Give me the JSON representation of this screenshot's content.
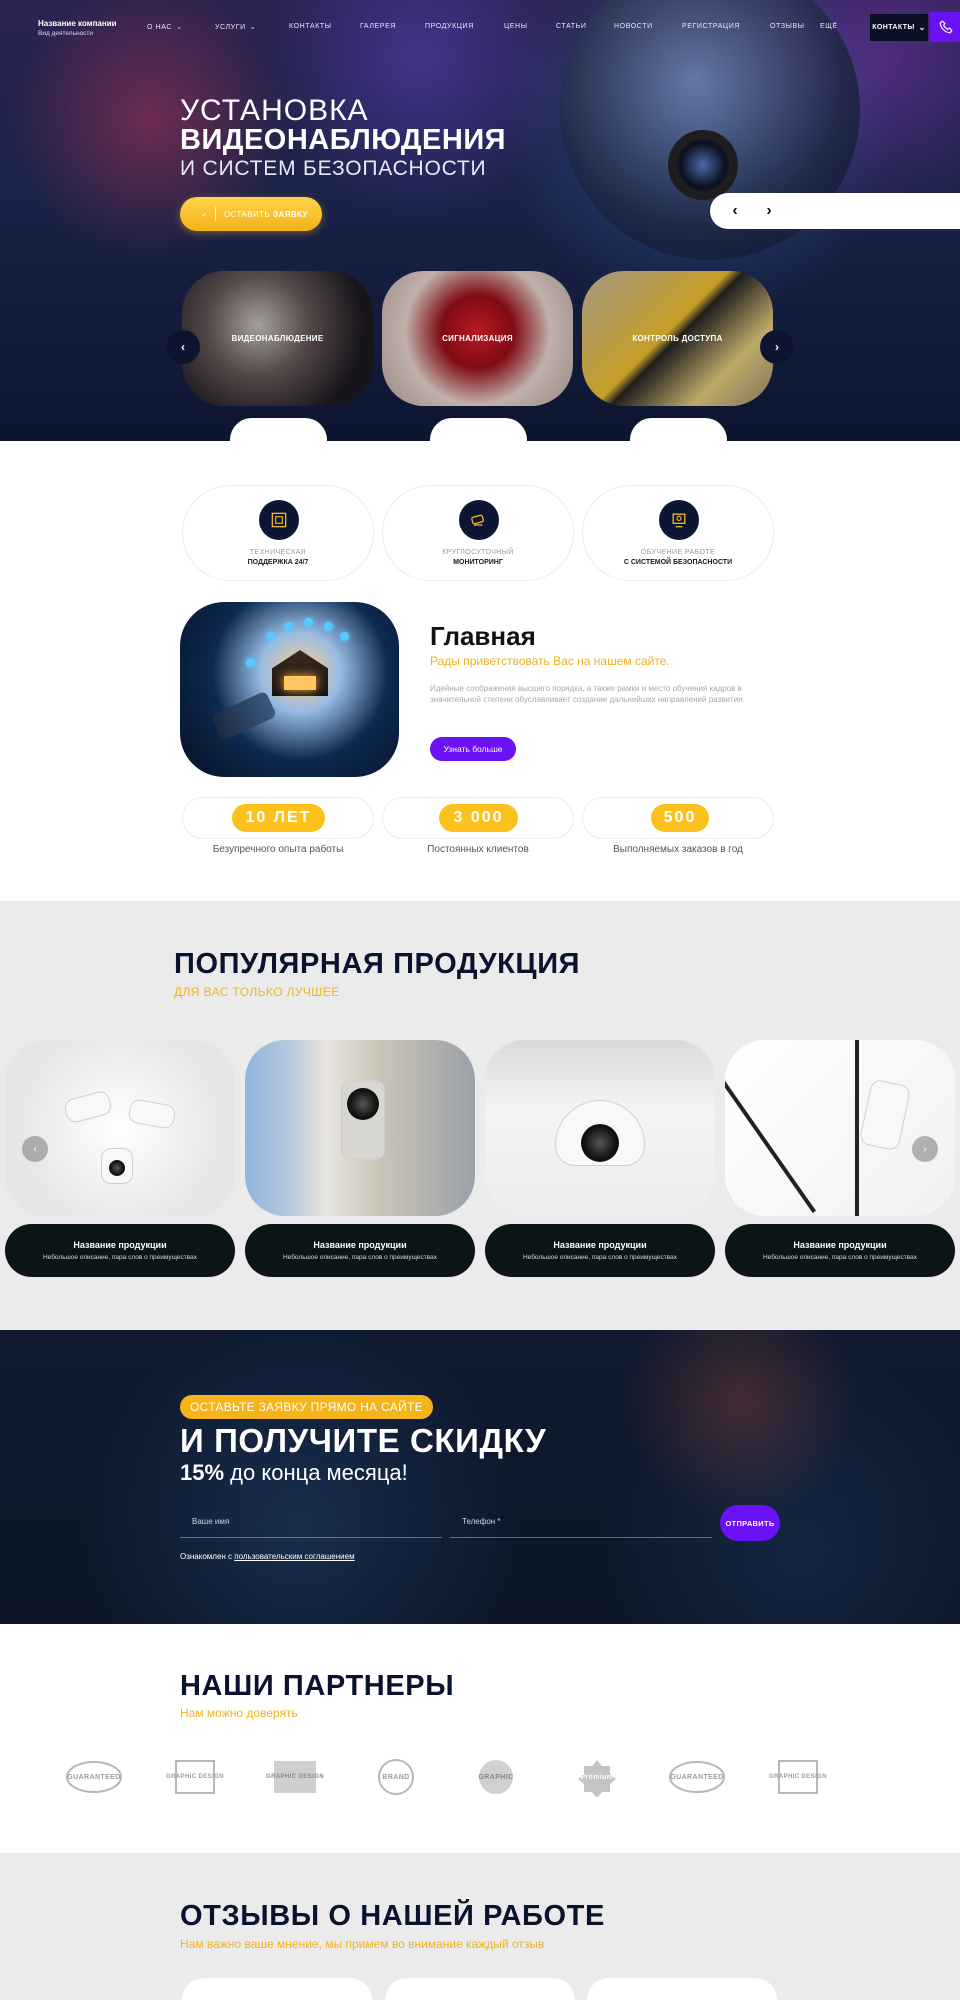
{
  "nav": {
    "company_name": "Название компании",
    "company_sub": "Вид деятельности",
    "links": [
      "О нас",
      "Услуги",
      "Контакты",
      "Галерея",
      "Продукция",
      "Цены",
      "Статьи",
      "Новости",
      "Регистрация",
      "Отзывы",
      "Ещё"
    ],
    "contacts_label": "КОНТАКТЫ"
  },
  "hero": {
    "line1": "УСТАНОВКА",
    "line2": "ВИДЕОНАБЛЮДЕНИЯ",
    "line3": "И СИСТЕМ БЕЗОПАСНОСТИ",
    "button_prefix": "ОСТАВИТЬ",
    "button_bold": "ЗАЯВКУ",
    "prev_arrow": "‹",
    "next_arrow": "›"
  },
  "services": [
    "ВИДЕОНАБЛЮДЕНИЕ",
    "СИГНАЛИЗАЦИЯ",
    "КОНТРОЛЬ ДОСТУПА"
  ],
  "features": [
    {
      "line1": "ТЕХНИЧЕСКАЯ",
      "line2": "ПОДДЕРЖКА 24/7",
      "icon": "support-icon"
    },
    {
      "line1": "КРУГЛОСУТОЧНЫЙ",
      "line2": "МОНИТОРИНГ",
      "icon": "camera-monitoring-icon"
    },
    {
      "line1": "ОБУЧЕНИЕ РАБОТЕ",
      "line2": "С СИСТЕМОЙ БЕЗОПАСНОСТИ",
      "icon": "training-icon"
    }
  ],
  "about": {
    "title": "Главная",
    "subtitle": "Рады приветствовать Вас на нашем сайте.",
    "text": "Идейные соображения высшего порядка, а также рамки и место обучения кадров в значительной степени обуславливает создание дальнейших направлений развития.",
    "button": "Узнать больше"
  },
  "stats": [
    {
      "value": "10 ЛЕТ",
      "label": "Безупречного опыта работы"
    },
    {
      "value": "3 000",
      "label": "Постоянных клиентов"
    },
    {
      "value": "500",
      "label": "Выполняемых заказов в год"
    }
  ],
  "products": {
    "title": "ПОПУЛЯРНАЯ ПРОДУКЦИЯ",
    "subtitle": "ДЛЯ ВАС ТОЛЬКО ЛУЧШЕЕ",
    "items": [
      {
        "name": "Название продукции",
        "desc": "Небольшое описание, пара слов о преимуществах"
      },
      {
        "name": "Название продукции",
        "desc": "Небольшое описание, пара слов о преимуществах"
      },
      {
        "name": "Название продукции",
        "desc": "Небольшое описание, пара слов о преимуществах"
      },
      {
        "name": "Название продукции",
        "desc": "Небольшое описание, пара слов о преимуществах"
      }
    ]
  },
  "cta": {
    "badge": "ОСТАВЬТЕ ЗАЯВКУ ПРЯМО НА САЙТЕ",
    "title": "И ПОЛУЧИТЕ СКИДКУ",
    "discount": "15%",
    "discount_text": " до конца месяца!",
    "name_placeholder": "Ваше имя",
    "phone_placeholder": "Телефон *",
    "send_button": "ОТПРАВИТЬ",
    "agree_prefix": "Ознакомлен с ",
    "agree_link": "пользовательским соглашением"
  },
  "partners": {
    "title": "НАШИ ПАРТНЕРЫ",
    "subtitle": "Нам можно доверять",
    "logos": [
      "GUARANTEED",
      "GRAPHIC DESIGN",
      "GRAPHIC DESIGN",
      "BRAND",
      "GRAPHIC",
      "Premium",
      "GUARANTEED",
      "GRAPHIC DESIGN"
    ]
  },
  "reviews": {
    "title": "ОТЗЫВЫ О НАШЕЙ РАБОТЕ",
    "subtitle": "Нам важно ваше мнение, мы примем во внимание каждый отзыв"
  },
  "colors": {
    "accent_yellow": "#f4b41a",
    "accent_purple": "#6a12f5",
    "navy": "#0b1230"
  }
}
